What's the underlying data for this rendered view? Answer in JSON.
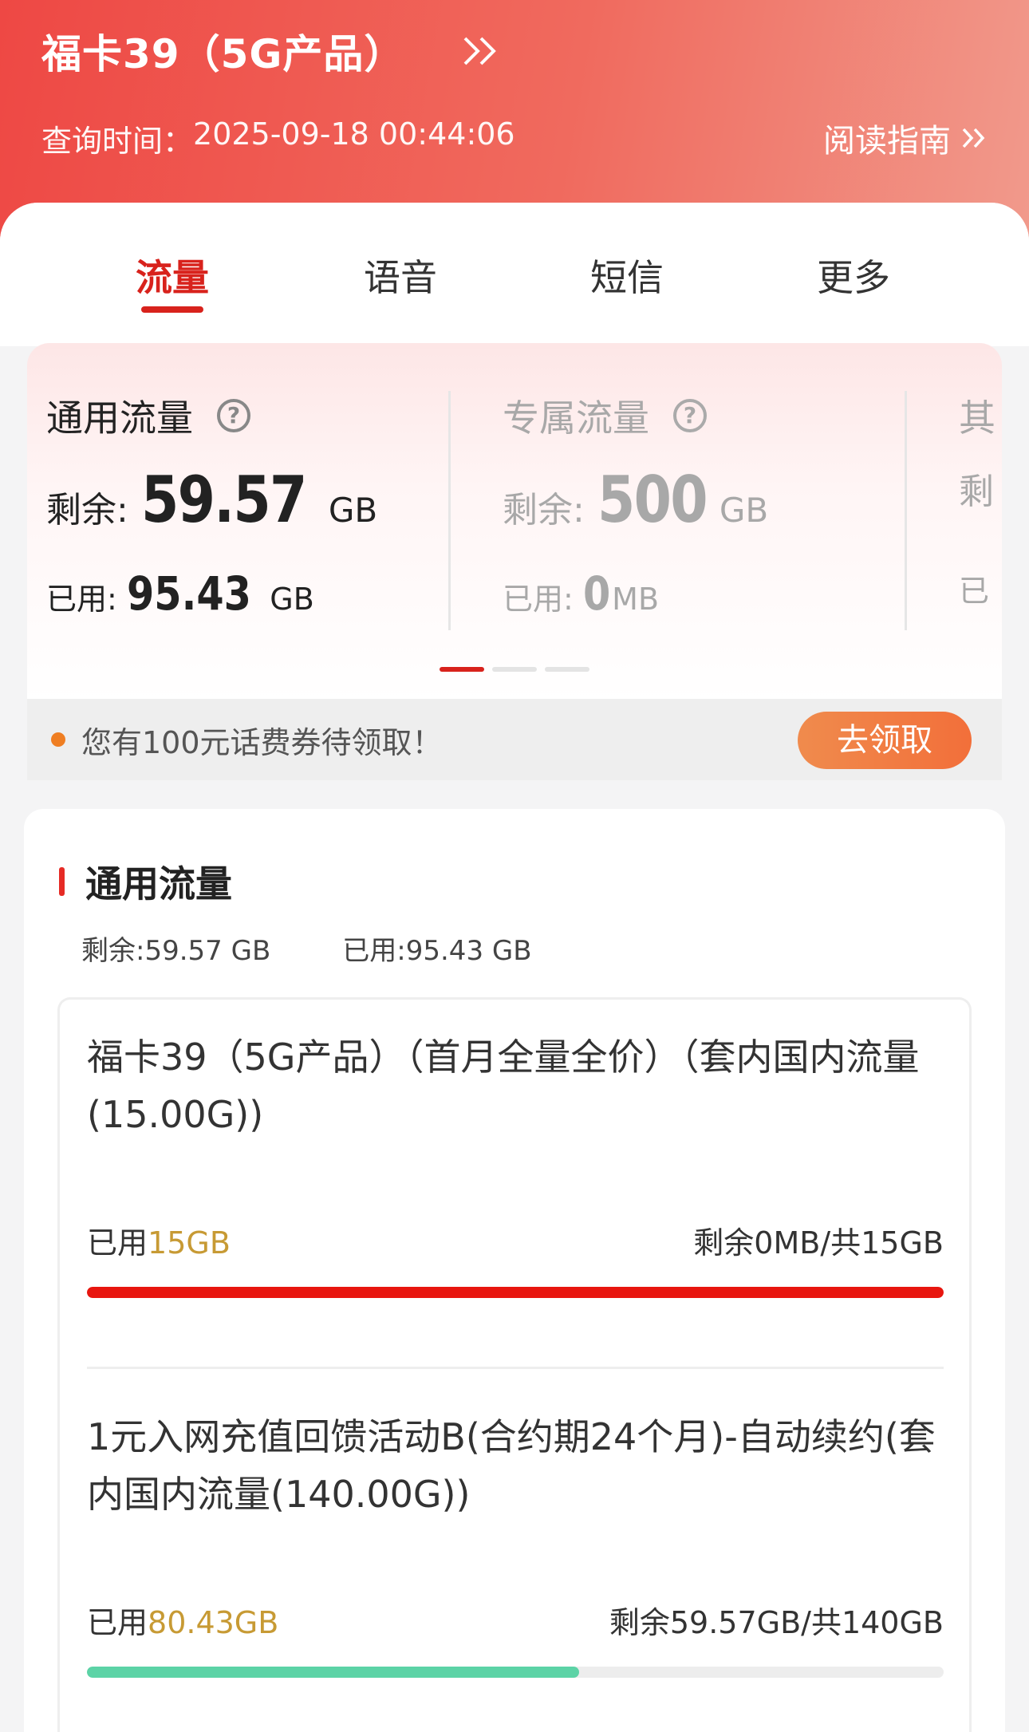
{
  "header": {
    "plan_name": "福卡39（5G产品）",
    "query_label": "查询时间：",
    "query_time": "2025-09-18 00:44:06",
    "guide_label": "阅读指南"
  },
  "tabs": [
    {
      "label": "流量",
      "active": true
    },
    {
      "label": "语音",
      "active": false
    },
    {
      "label": "短信",
      "active": false
    },
    {
      "label": "更多",
      "active": false
    }
  ],
  "usage_cards": [
    {
      "title": "通用流量",
      "remain_label": "剩余:",
      "remain_value": "59.57",
      "remain_unit": "GB",
      "used_label": "已用:",
      "used_value": "95.43",
      "used_unit": "GB"
    },
    {
      "title": "专属流量",
      "remain_label": "剩余:",
      "remain_value": "500",
      "remain_unit": "GB",
      "used_label": "已用:",
      "used_value": "0",
      "used_unit": "MB"
    },
    {
      "title": "其",
      "remain_label": "剩",
      "used_label": "已"
    }
  ],
  "coupon": {
    "text": "您有100元话费券待领取！",
    "button": "去领取"
  },
  "detail": {
    "title": "通用流量",
    "remain_summary": "剩余:59.57 GB",
    "used_summary": "已用:95.43 GB",
    "items": [
      {
        "name": "福卡39（5G产品）（首月全量全价）（套内国内流量(15.00G))",
        "used_label": "已用",
        "used_amount": "15GB",
        "remain_total": "剩余0MB/共15GB",
        "progress": 1.0,
        "color": "#e8160f"
      },
      {
        "name": "1元入网充值回馈活动B(合约期24个月)-自动续约(套内国内流量(140.00G))",
        "used_label": "已用",
        "used_amount": "80.43GB",
        "remain_total": "剩余59.57GB/共140GB",
        "progress": 0.5745,
        "color": "#5cd3a6"
      }
    ]
  },
  "colors": {
    "accent": "#d8221c",
    "header_start": "#ee4844",
    "gold": "#c79a34",
    "claim_button": "#f26f3a"
  }
}
